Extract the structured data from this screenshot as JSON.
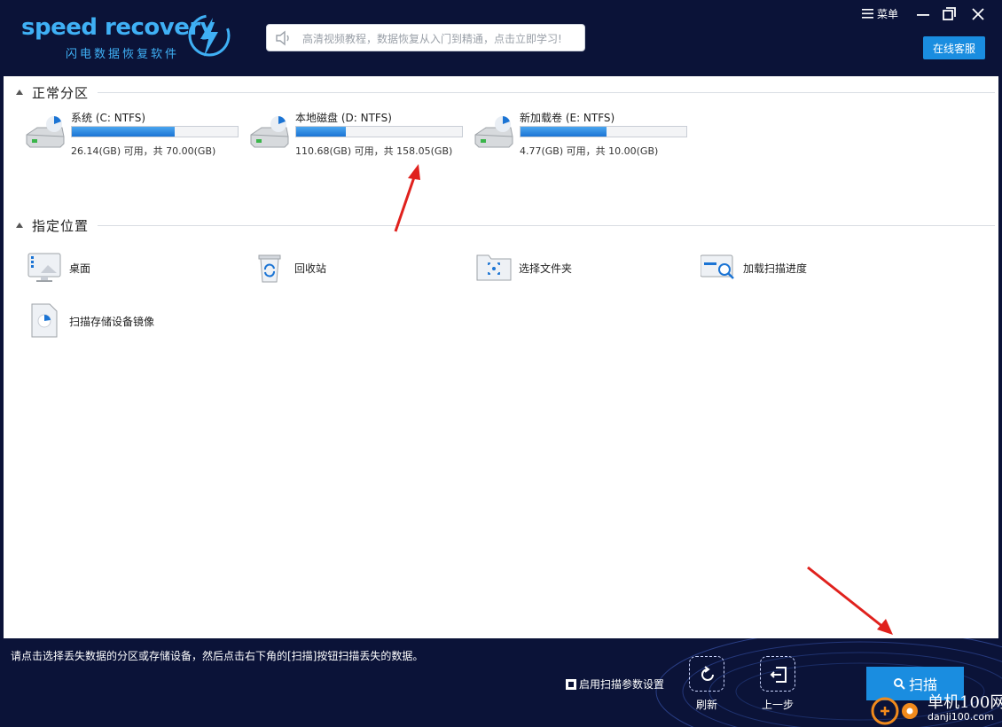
{
  "header": {
    "logo_text": "speed recovery",
    "logo_subtitle": "闪电数据恢复软件",
    "notice": "高清视频教程，数据恢复从入门到精通，点击立即学习!",
    "menu_label": "菜单",
    "online_service": "在线客服"
  },
  "partitions": {
    "title": "正常分区",
    "items": [
      {
        "name": "系统 (C: NTFS)",
        "info": "26.14(GB) 可用，共 70.00(GB)",
        "used_fraction": 0.62
      },
      {
        "name": "本地磁盘 (D: NTFS)",
        "info": "110.68(GB) 可用，共 158.05(GB)",
        "used_fraction": 0.3
      },
      {
        "name": "新加载卷 (E: NTFS)",
        "info": "4.77(GB) 可用，共 10.00(GB)",
        "used_fraction": 0.52
      }
    ]
  },
  "locations": {
    "title": "指定位置",
    "items": [
      {
        "label": "桌面",
        "icon": "desktop-icon"
      },
      {
        "label": "回收站",
        "icon": "recycle-bin-icon"
      },
      {
        "label": "选择文件夹",
        "icon": "folder-icon"
      },
      {
        "label": "加载扫描进度",
        "icon": "load-progress-icon"
      },
      {
        "label": "扫描存储设备镜像",
        "icon": "disk-image-icon"
      }
    ]
  },
  "footer": {
    "hint": "请点击选择丢失数据的分区或存储设备，然后点击右下角的[扫描]按钮扫描丢失的数据。",
    "scan_params_label": "启用扫描参数设置",
    "scan_params_checked": true,
    "refresh_label": "刷新",
    "back_label": "上一步",
    "scan_label": "扫描"
  },
  "watermark": {
    "name": "单机100网",
    "url": "danji100.com"
  },
  "colors": {
    "background": "#0b1338",
    "accent": "#1a8de0",
    "logo": "#3fb0f5",
    "annotation_arrow": "#e0211d"
  }
}
